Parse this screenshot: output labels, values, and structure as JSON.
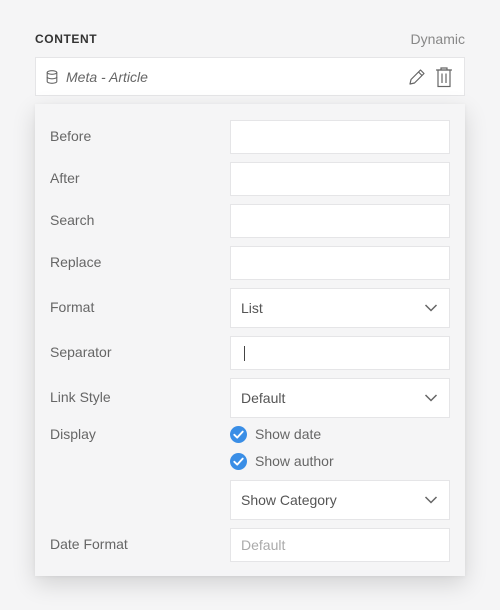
{
  "header": {
    "title": "CONTENT",
    "mode": "Dynamic"
  },
  "source": {
    "icon": "database-icon",
    "name": "Meta - Article"
  },
  "fields": {
    "before": {
      "label": "Before",
      "value": ""
    },
    "after": {
      "label": "After",
      "value": ""
    },
    "search": {
      "label": "Search",
      "value": ""
    },
    "replace": {
      "label": "Replace",
      "value": ""
    },
    "format": {
      "label": "Format",
      "selected": "List"
    },
    "separator": {
      "label": "Separator",
      "value": ""
    },
    "link_style": {
      "label": "Link Style",
      "selected": "Default"
    },
    "display": {
      "label": "Display",
      "show_date": {
        "label": "Show date",
        "checked": true
      },
      "show_author": {
        "label": "Show author",
        "checked": true
      },
      "category_select": "Show Category"
    },
    "date_format": {
      "label": "Date Format",
      "placeholder": "Default"
    }
  },
  "colors": {
    "accent": "#3a8ee6",
    "background": "#f5f5f6",
    "input_bg": "#ffffff"
  }
}
